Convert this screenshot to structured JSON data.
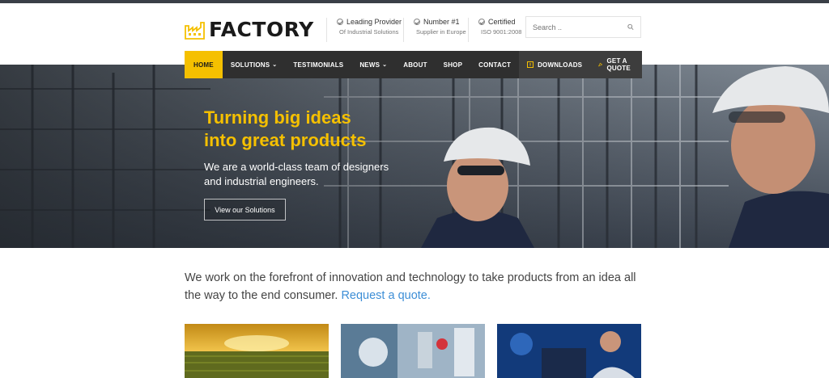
{
  "brand": {
    "name": "FACTORY"
  },
  "header_info": [
    {
      "title": "Leading Provider",
      "sub": "Of Industrial Solutions"
    },
    {
      "title": "Number #1",
      "sub": "Supplier in Europe"
    },
    {
      "title": "Certified",
      "sub": "ISO 9001:2008"
    }
  ],
  "search": {
    "placeholder": "Search .."
  },
  "nav": {
    "items": [
      {
        "label": "HOME",
        "active": true
      },
      {
        "label": "SOLUTIONS",
        "dropdown": true
      },
      {
        "label": "TESTIMONIALS"
      },
      {
        "label": "NEWS",
        "dropdown": true
      },
      {
        "label": "ABOUT"
      },
      {
        "label": "SHOP"
      },
      {
        "label": "CONTACT"
      }
    ],
    "downloads": "DOWNLOADS",
    "quote": "GET A QUOTE"
  },
  "hero": {
    "title_line1": "Turning big ideas",
    "title_line2": "into great products",
    "sub_line1": "We are a world-class team of designers",
    "sub_line2": "and industrial engineers.",
    "button": "View our Solutions"
  },
  "intro": {
    "text": "We work on the forefront of innovation and technology to take products from an idea all the way to the end consumer.",
    "link": "Request a quote."
  },
  "colors": {
    "accent": "#f5c000",
    "nav_bg": "#2f2f2f",
    "link": "#3d8ed6"
  }
}
